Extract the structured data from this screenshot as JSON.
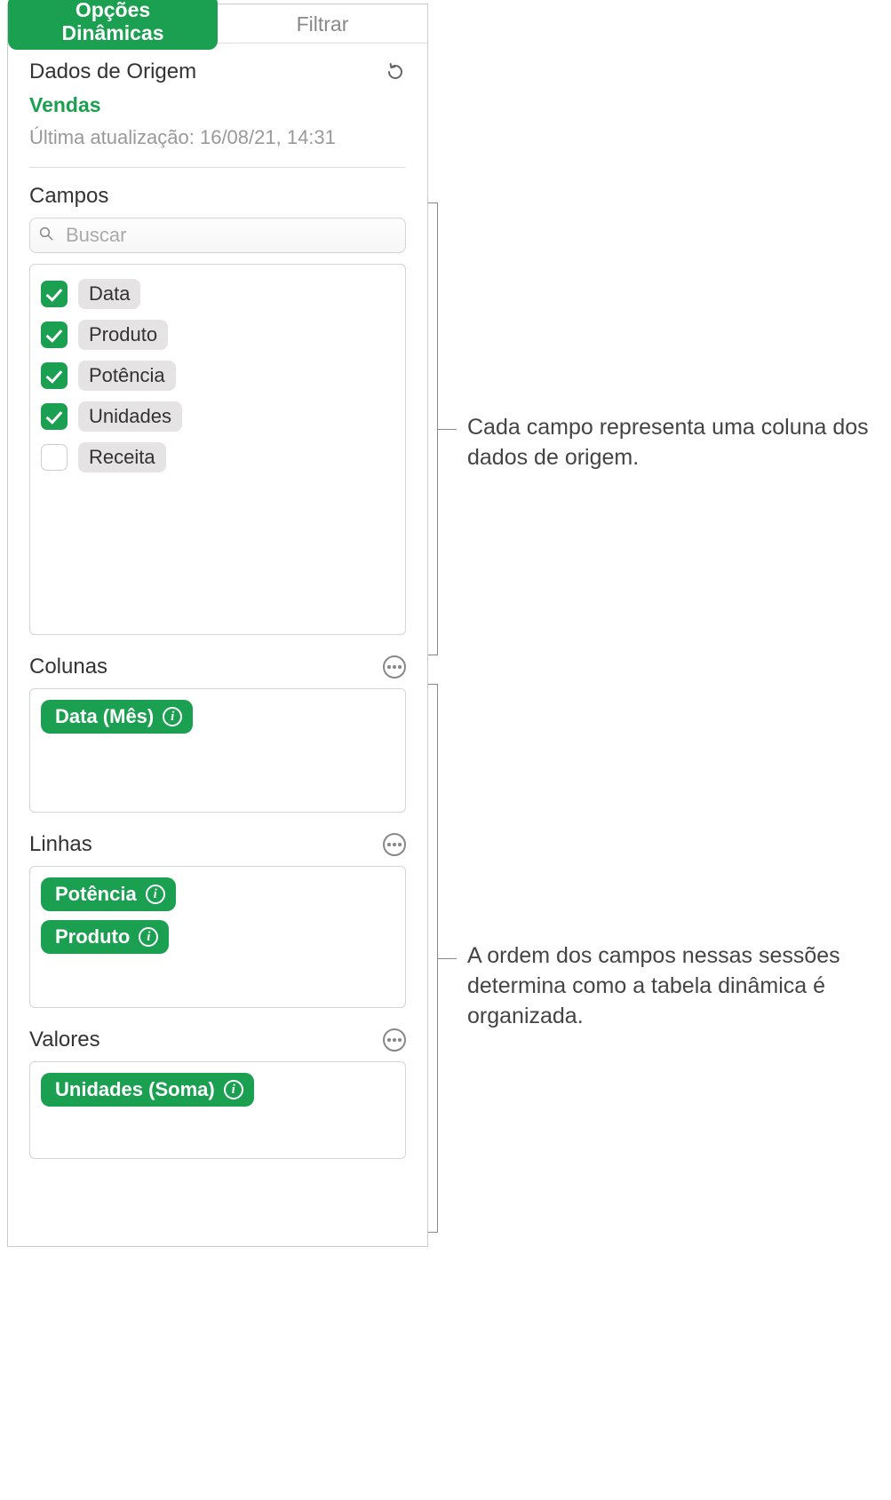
{
  "tabs": {
    "active": "Opções Dinâmicas",
    "inactive": "Filtrar"
  },
  "origin": {
    "title": "Dados de Origem",
    "name": "Vendas",
    "last_update": "Última atualização: 16/08/21, 14:31"
  },
  "fields": {
    "label": "Campos",
    "search_placeholder": "Buscar",
    "items": [
      {
        "label": "Data",
        "checked": true
      },
      {
        "label": "Produto",
        "checked": true
      },
      {
        "label": "Potência",
        "checked": true
      },
      {
        "label": "Unidades",
        "checked": true
      },
      {
        "label": "Receita",
        "checked": false
      }
    ]
  },
  "columns": {
    "label": "Colunas",
    "tokens": [
      "Data (Mês)"
    ]
  },
  "rows": {
    "label": "Linhas",
    "tokens": [
      "Potência",
      "Produto"
    ]
  },
  "values": {
    "label": "Valores",
    "tokens": [
      "Unidades (Soma)"
    ]
  },
  "callouts": {
    "fields": "Cada campo representa uma coluna dos dados de origem.",
    "order": "A ordem dos campos nessas sessões determina como a tabela dinâmica é organizada."
  }
}
